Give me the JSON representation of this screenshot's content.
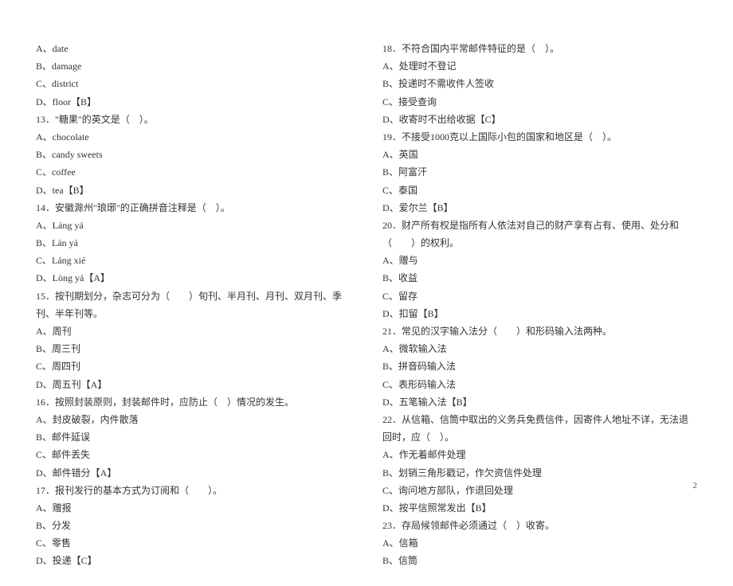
{
  "left_column": [
    "A、date",
    "B、damage",
    "C、district",
    "D、floor【B】",
    "13．\"糖果\"的英文是（　）。",
    "A、chocolate",
    "B、candy sweets",
    "C、coffee",
    "D、tea【B】",
    "14．安徽滁州\"琅琊\"的正确拼音注释是（　）。",
    "A、Láng yá",
    "B、Lán yá",
    "C、Láng xié",
    "D、Lòng yá【A】",
    "15．按刊期划分，杂志可分为（　　）旬刊、半月刊、月刊、双月刊、季刊、半年刊等。",
    "A、周刊",
    "B、周三刊",
    "C、周四刊",
    "D、周五刊【A】",
    "16．按照封装原则，封装邮件时，应防止（　）情况的发生。",
    "A、封皮破裂，内件散落",
    "B、邮件延误",
    "C、邮件丢失",
    "D、邮件错分【A】",
    "17．报刊发行的基本方式为订阅和（　　）。",
    "A、赠报",
    "B、分发",
    "C、零售",
    "D、投递【C】"
  ],
  "right_column": [
    "18．不符合国内平常邮件特征的是（　）。",
    "A、处理时不登记",
    "B、投递时不需收件人签收",
    "C、接受查询",
    "D、收寄时不出给收据【C】",
    "19．不接受1000克以上国际小包的国家和地区是（　）。",
    "A、英国",
    "B、阿富汗",
    "C、泰国",
    "D、爱尔兰【B】",
    "20．财产所有权是指所有人依法对自己的财产享有占有、使用、处分和（　　）的权利。",
    "A、赠与",
    "B、收益",
    "C、留存",
    "D、扣留【B】",
    "21．常见的汉字输入法分（　　）和形码输入法两种。",
    "A、微软输入法",
    "B、拼音码输入法",
    "C、表形码输入法",
    "D、五笔输入法【B】",
    "22．从信箱、信筒中取出的义务兵免费信件，因寄件人地址不详，无法退回时，应（　）。",
    "A、作无着邮件处理",
    "B、划销三角形戳记，作欠资信件处理",
    "C、询问地方部队，作退回处理",
    "D、按平信照常发出【B】",
    "23．存局候领邮件必须通过（　）收寄。",
    "A、信箱",
    "B、信筒"
  ],
  "page_number": "2"
}
